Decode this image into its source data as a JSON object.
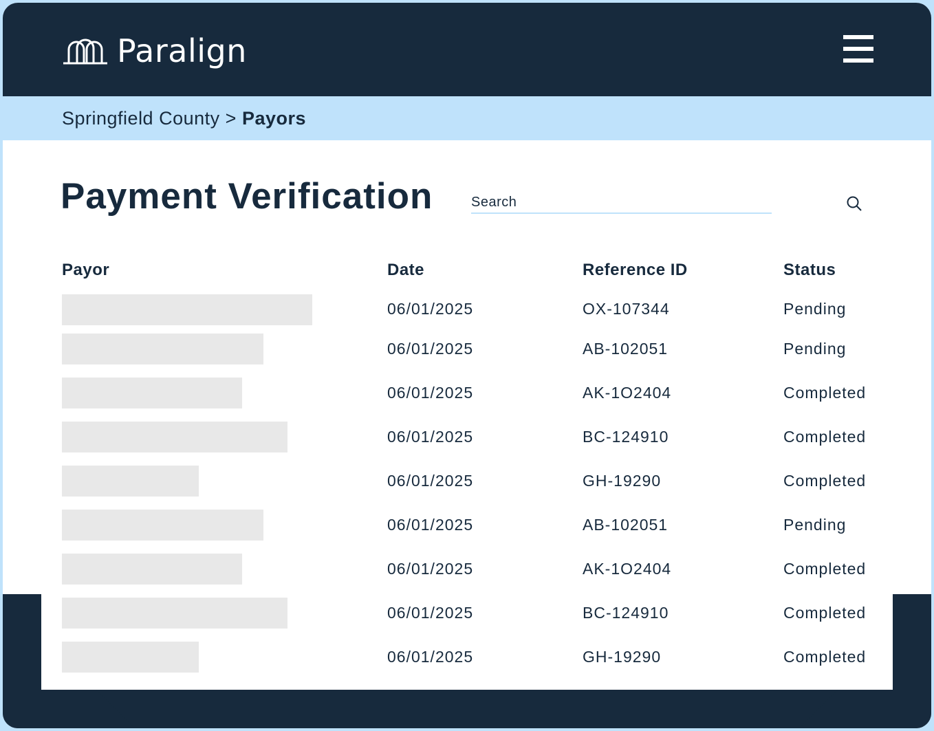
{
  "app": {
    "name": "Paralign",
    "logo_icon": "arch-logo-icon",
    "menu_icon": "hamburger-menu-icon"
  },
  "breadcrumb": {
    "parent": "Springfield County",
    "separator": ">",
    "current": "Payors"
  },
  "page": {
    "title": "Payment Verification"
  },
  "search": {
    "placeholder": "Search",
    "icon": "search-icon"
  },
  "table": {
    "headers": {
      "payor": "Payor",
      "date": "Date",
      "reference": "Reference ID",
      "status": "Status"
    },
    "rows": [
      {
        "date": "06/01/2025",
        "reference": "OX-107344",
        "status": "Pending"
      },
      {
        "date": "06/01/2025",
        "reference": "AB-102051",
        "status": "Pending"
      },
      {
        "date": "06/01/2025",
        "reference": "AK-1O2404",
        "status": "Completed"
      },
      {
        "date": "06/01/2025",
        "reference": "BC-124910",
        "status": "Completed"
      },
      {
        "date": "06/01/2025",
        "reference": "GH-19290",
        "status": "Completed"
      },
      {
        "date": "06/01/2025",
        "reference": "AB-102051",
        "status": "Pending"
      },
      {
        "date": "06/01/2025",
        "reference": "AK-1O2404",
        "status": "Completed"
      },
      {
        "date": "06/01/2025",
        "reference": "BC-124910",
        "status": "Completed"
      },
      {
        "date": "06/01/2025",
        "reference": "GH-19290",
        "status": "Completed"
      }
    ]
  },
  "colors": {
    "navy": "#172a3d",
    "light_blue": "#bfe2fb",
    "placeholder_gray": "#e8e8e8"
  }
}
